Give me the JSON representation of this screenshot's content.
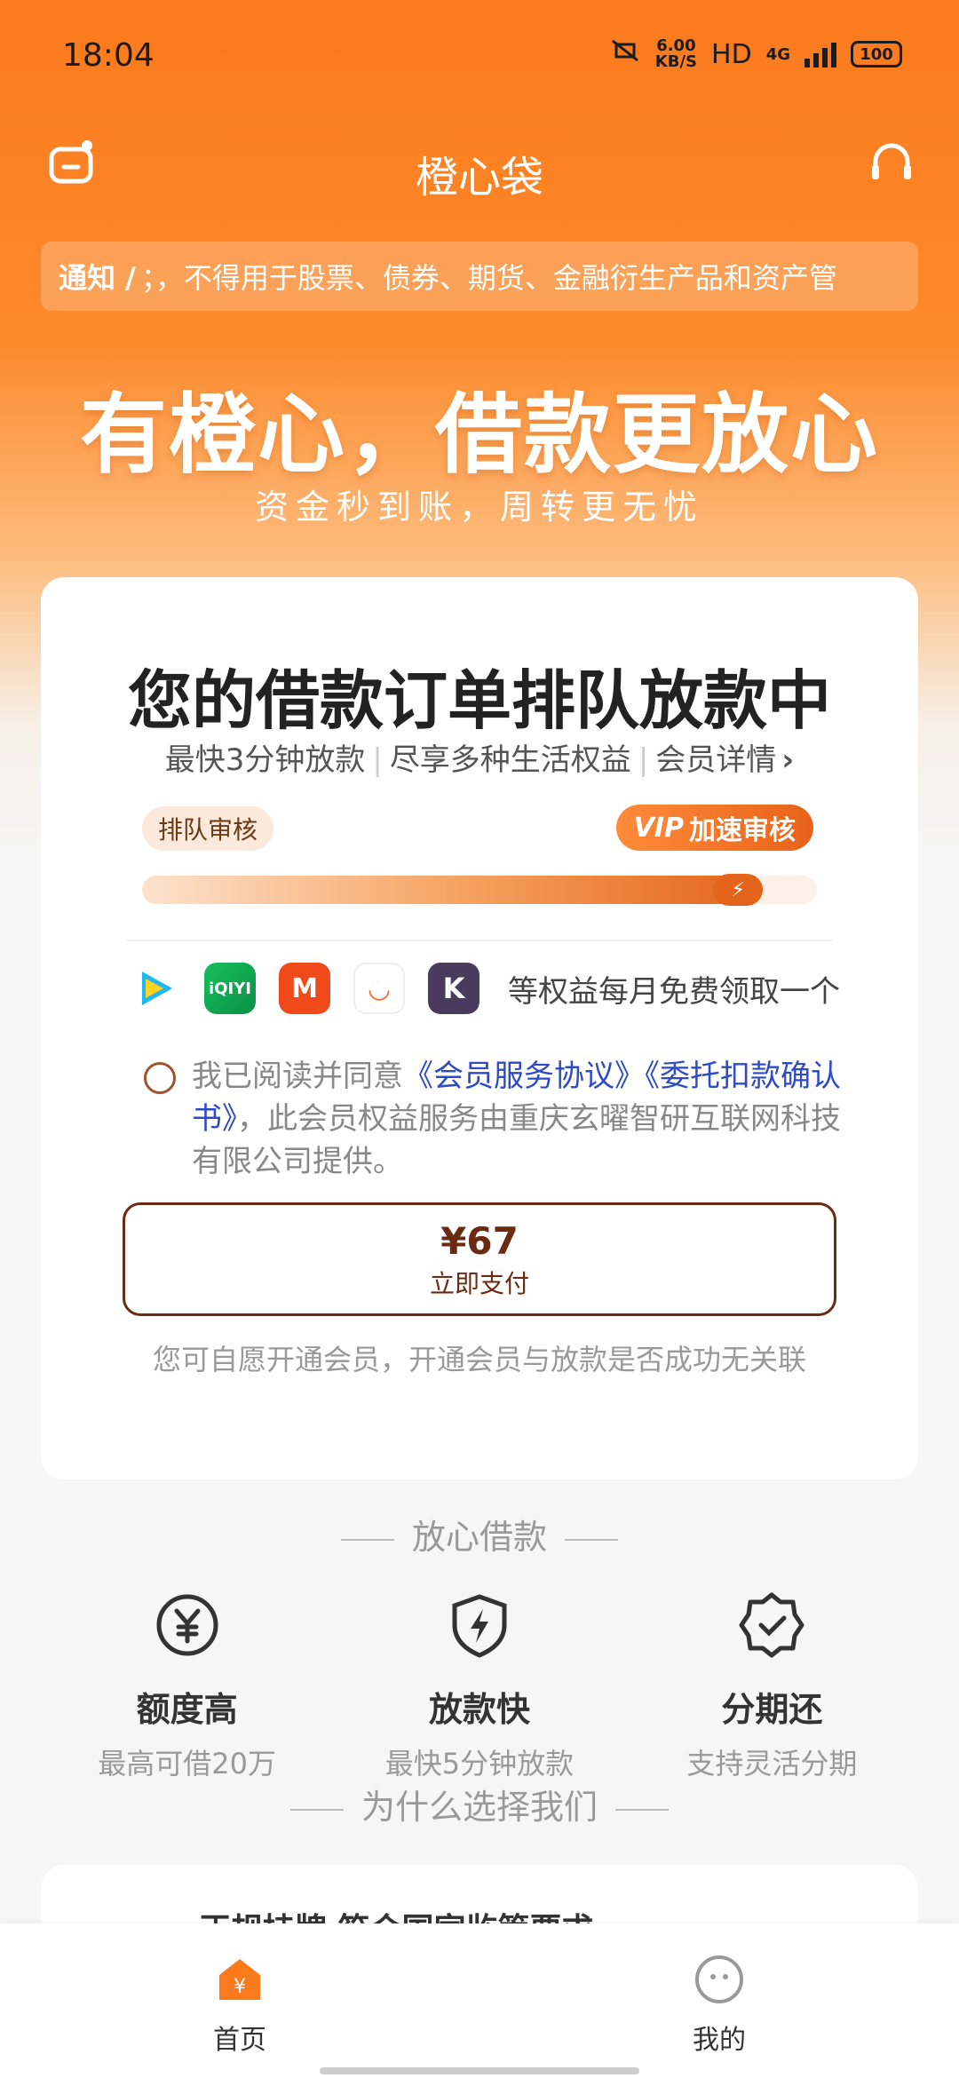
{
  "status": {
    "time": "18:04",
    "speed_value": "6.00",
    "speed_unit": "KB/S",
    "hd": "HD",
    "network": "4G",
    "battery": "100"
  },
  "nav": {
    "title": "橙心袋"
  },
  "notice": {
    "label": "通知 /",
    "text": "；，不得用于股票、债券、期货、金融衍生产品和资产管"
  },
  "hero": {
    "slogan": "有橙心，借款更放心",
    "sub": "资金秒到账，周转更无忧"
  },
  "card": {
    "title": "您的借款订单排队放款中",
    "sub_items": [
      "最快3分钟放款",
      "尽享多种生活权益",
      "会员详情"
    ],
    "queue_label": "排队审核",
    "vip_prefix": "VIP",
    "vip_label": "加速审核",
    "progress_fraction": 0.92,
    "apps": [
      {
        "name": "tencent-video-icon",
        "label": "▶",
        "color": "#1fb8f5"
      },
      {
        "name": "iqiyi-icon",
        "label": "iQIYI",
        "color": "#16c05b"
      },
      {
        "name": "mango-tv-icon",
        "label": "M",
        "color": "#f04a1b"
      },
      {
        "name": "cup-icon",
        "label": "◡",
        "color": "#ff6a2a"
      },
      {
        "name": "k-icon",
        "label": "K",
        "color": "#4a3a5e"
      }
    ],
    "apps_text": "等权益每月免费领取一个",
    "agree_prefix": "我已阅读并同意",
    "agree_link1": "《会员服务协议》",
    "agree_link2": "《委托扣款确认书》",
    "agree_suffix": "，此会员权益服务由重庆玄曜智研互联网科技有限公司提供。",
    "pay_price": "¥67",
    "pay_label": "立即支付",
    "pay_note": "您可自愿开通会员，开通会员与放款是否成功无关联"
  },
  "section": {
    "title": "放心借款",
    "features": [
      {
        "title": "额度高",
        "sub": "最高可借20万",
        "icon": "yuan-icon"
      },
      {
        "title": "放款快",
        "sub": "最快5分钟放款",
        "icon": "lightning-shield-icon"
      },
      {
        "title": "分期还",
        "sub": "支持灵活分期",
        "icon": "check-badge-icon"
      }
    ],
    "why_title": "为什么选择我们",
    "promo_text": "正规持牌 符合国家监管要求"
  },
  "tabs": [
    {
      "label": "首页",
      "active": true
    },
    {
      "label": "我的",
      "active": false
    }
  ],
  "colors": {
    "brand": "#fb7a1c",
    "link": "#2f4ac6",
    "pay_border": "#6b2b12"
  }
}
